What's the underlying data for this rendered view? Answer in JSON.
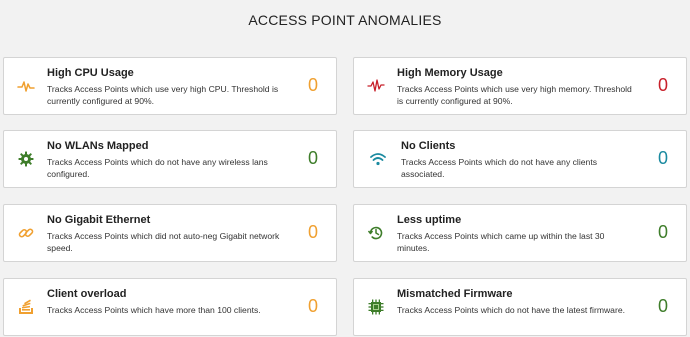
{
  "page": {
    "title": "ACCESS POINT ANOMALIES"
  },
  "cards": [
    {
      "title": "High CPU Usage",
      "description": "Tracks Access Points which use very high CPU. Threshold is currently configured at 90%.",
      "count": "0",
      "icon": "pulse-icon",
      "color": "#f0a030"
    },
    {
      "title": "High Memory Usage",
      "description": "Tracks Access Points which use very high memory. Threshold is currently configured at 90%.",
      "count": "0",
      "icon": "heartbeat-icon",
      "color": "#c8202a"
    },
    {
      "title": "No WLANs Mapped",
      "description": "Tracks Access Points which do not have any wireless lans configured.",
      "count": "0",
      "icon": "gear-icon",
      "color": "#3e7d2a"
    },
    {
      "title": "No Clients",
      "description": "Tracks Access Points which do not have any clients associated.",
      "count": "0",
      "icon": "wifi-icon",
      "color": "#1a8aa0"
    },
    {
      "title": "No Gigabit Ethernet",
      "description": "Tracks Access Points which did not auto-neg Gigabit network speed.",
      "count": "0",
      "icon": "link-icon",
      "color": "#f0a030"
    },
    {
      "title": "Less uptime",
      "description": "Tracks Access Points which came up within the last 30 minutes.",
      "count": "0",
      "icon": "history-icon",
      "color": "#3e7d2a"
    },
    {
      "title": "Client overload",
      "description": "Tracks Access Points which have more than 100 clients.",
      "count": "0",
      "icon": "stack-icon",
      "color": "#f0a030"
    },
    {
      "title": "Mismatched Firmware",
      "description": "Tracks Access Points which do not have the latest firmware.",
      "count": "0",
      "icon": "chip-icon",
      "color": "#3e7d2a"
    }
  ]
}
